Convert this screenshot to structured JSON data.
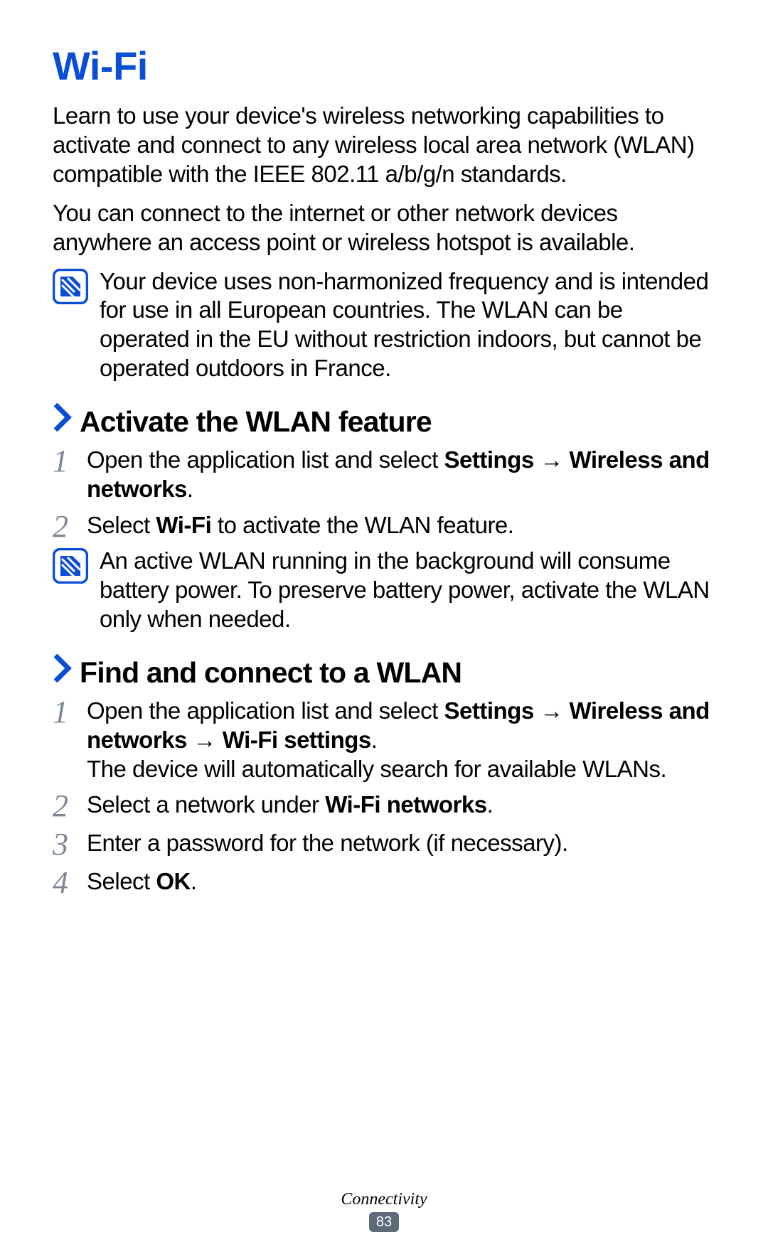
{
  "title": "Wi-Fi",
  "intro": {
    "p1": "Learn to use your device's wireless networking capabilities to activate and connect to any wireless local area network (WLAN) compatible with the IEEE 802.11 a/b/g/n standards.",
    "p2": "You can connect to the internet or other network devices anywhere an access point or wireless hotspot is available."
  },
  "note1": "Your device uses non-harmonized frequency and is intended for use in all European countries. The WLAN can be operated in the EU without restriction indoors, but cannot be operated outdoors in France.",
  "sectionA": {
    "title": "Activate the WLAN feature",
    "steps": [
      {
        "num": "1",
        "html": "Open the application list and select <b>Settings</b> → <b>Wireless and networks</b>."
      },
      {
        "num": "2",
        "html": "Select <b>Wi-Fi</b> to activate the WLAN feature."
      }
    ],
    "note": "An active WLAN running in the background will consume battery power. To preserve battery power, activate the WLAN only when needed."
  },
  "sectionB": {
    "title": "Find and connect to a WLAN",
    "steps": [
      {
        "num": "1",
        "html": "Open the application list and select <b>Settings</b> → <b>Wireless and networks</b> → <b>Wi-Fi settings</b>.<br>The device will automatically search for available WLANs."
      },
      {
        "num": "2",
        "html": "Select a network under <b>Wi-Fi networks</b>."
      },
      {
        "num": "3",
        "html": "Enter a password for the network (if necessary)."
      },
      {
        "num": "4",
        "html": "Select <b>OK</b>."
      }
    ]
  },
  "footer": {
    "section": "Connectivity",
    "page": "83"
  }
}
